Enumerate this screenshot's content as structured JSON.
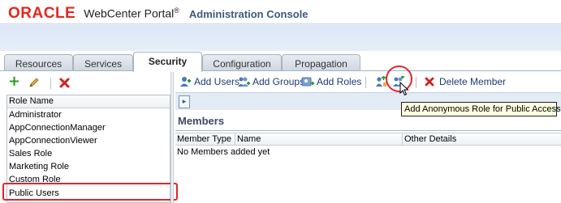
{
  "header": {
    "logo_text": "ORACLE",
    "product_name": "WebCenter Portal",
    "product_mark": "®",
    "console_title": "Administration Console"
  },
  "tabs": [
    {
      "label": "Resources",
      "active": false
    },
    {
      "label": "Services",
      "active": false
    },
    {
      "label": "Security",
      "active": true
    },
    {
      "label": "Configuration",
      "active": false
    },
    {
      "label": "Propagation",
      "active": false
    }
  ],
  "left_toolbar": {
    "icons": [
      "add-icon",
      "edit-pencil-icon",
      "delete-icon"
    ]
  },
  "roles": {
    "column_header": "Role Name",
    "items": [
      "Administrator",
      "AppConnectionManager",
      "AppConnectionViewer",
      "Sales Role",
      "Marketing Role",
      "Custom Role",
      "Public Users"
    ],
    "selected": "Public Users"
  },
  "right_toolbar": {
    "add_users": "Add Users",
    "add_groups": "Add Groups",
    "add_roles": "Add Roles",
    "delete_member": "Delete Member"
  },
  "members": {
    "title": "Members",
    "columns": [
      "Member Type",
      "Name",
      "Other Details"
    ],
    "empty_text": "No Members added yet"
  },
  "tooltip": "Add Anonymous Role for Public Access",
  "colors": {
    "oracle_red": "#e8261b",
    "callout_red": "#e0262a",
    "link_blue": "#1c3c70",
    "tooltip_bg": "#ffffe1"
  }
}
